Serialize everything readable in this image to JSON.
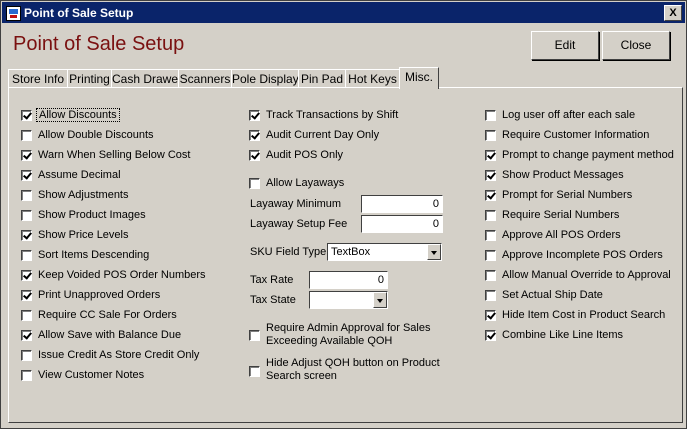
{
  "window": {
    "title": "Point of Sale Setup",
    "close_glyph": "X"
  },
  "header": {
    "heading": "Point of Sale Setup",
    "edit_label": "Edit",
    "close_label": "Close"
  },
  "tabs": [
    "Store Info",
    "Printing",
    "Cash Drawer",
    "Scanners",
    "Pole Display",
    "Pin Pad",
    "Hot Keys",
    "Misc."
  ],
  "active_tab": "Misc.",
  "col1": [
    {
      "label": "Allow Discounts",
      "checked": true
    },
    {
      "label": "Allow Double Discounts",
      "checked": false
    },
    {
      "label": "Warn When Selling Below Cost",
      "checked": true
    },
    {
      "label": "Assume Decimal",
      "checked": true
    },
    {
      "label": "Show Adjustments",
      "checked": false
    },
    {
      "label": "Show Product Images",
      "checked": false
    },
    {
      "label": "Show Price Levels",
      "checked": true
    },
    {
      "label": "Sort Items Descending",
      "checked": false
    },
    {
      "label": "Keep Voided POS Order Numbers",
      "checked": true
    },
    {
      "label": "Print Unapproved Orders",
      "checked": true
    },
    {
      "label": "Require CC Sale For Orders",
      "checked": false
    },
    {
      "label": "Allow Save with Balance Due",
      "checked": true
    },
    {
      "label": "Issue Credit As Store Credit Only",
      "checked": false
    },
    {
      "label": "View Customer Notes",
      "checked": false
    }
  ],
  "col2": {
    "track_shift": {
      "label": "Track Transactions by Shift",
      "checked": true
    },
    "audit_day": {
      "label": "Audit Current Day Only",
      "checked": true
    },
    "audit_pos": {
      "label": "Audit POS Only",
      "checked": true
    },
    "allow_layaways": {
      "label": "Allow Layaways",
      "checked": false
    },
    "layaway_min_label": "Layaway Minimum",
    "layaway_min_value": "0",
    "layaway_fee_label": "Layaway Setup Fee",
    "layaway_fee_value": "0",
    "sku_label": "SKU Field Type",
    "sku_value": "TextBox",
    "tax_rate_label": "Tax Rate",
    "tax_rate_value": "0",
    "tax_state_label": "Tax State",
    "tax_state_value": "",
    "admin_approval": {
      "label": "Require Admin Approval for Sales Exceeding Available QOH",
      "checked": false
    },
    "hide_adjust": {
      "label": "Hide Adjust QOH button on Product Search screen",
      "checked": false
    }
  },
  "col3": [
    {
      "label": "Log user off after each sale",
      "checked": false
    },
    {
      "label": "Require Customer Information",
      "checked": false
    },
    {
      "label": "Prompt to change payment method",
      "checked": true
    },
    {
      "label": "Show Product Messages",
      "checked": true
    },
    {
      "label": "Prompt for Serial Numbers",
      "checked": true
    },
    {
      "label": "Require Serial Numbers",
      "checked": false
    },
    {
      "label": "Approve All POS Orders",
      "checked": false
    },
    {
      "label": "Approve Incomplete POS Orders",
      "checked": false
    },
    {
      "label": "Allow Manual Override to Approval",
      "checked": false
    },
    {
      "label": "Set Actual Ship Date",
      "checked": false
    },
    {
      "label": "Hide Item Cost in Product Search",
      "checked": true
    },
    {
      "label": "Combine Like Line Items",
      "checked": true
    }
  ]
}
